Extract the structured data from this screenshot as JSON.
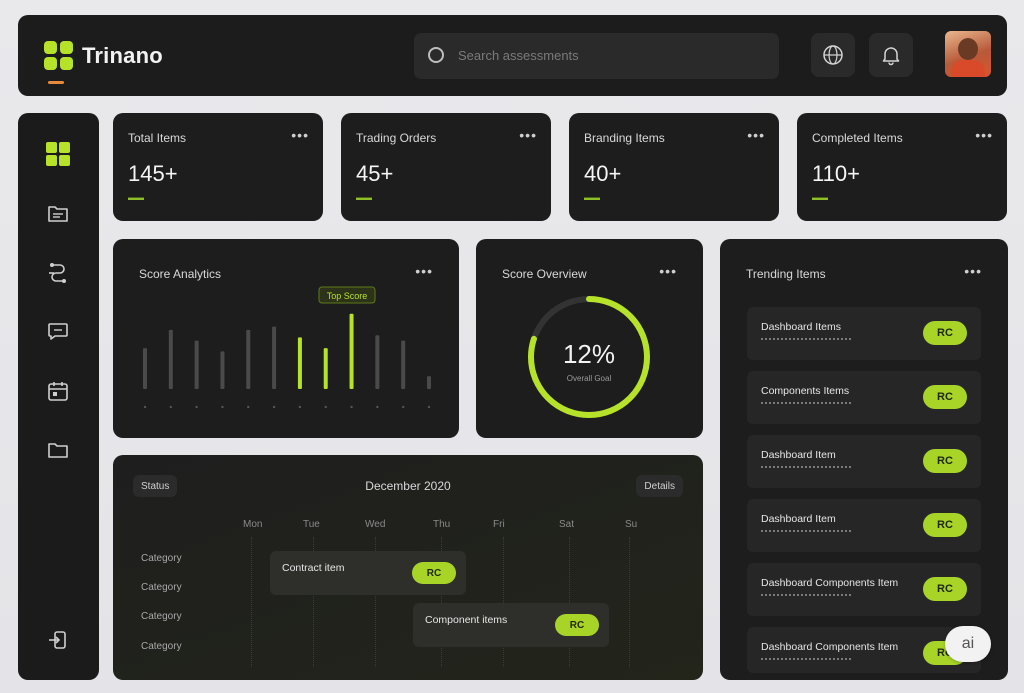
{
  "header": {
    "brand": "Trinano",
    "search_placeholder": "Search assessments",
    "icons": [
      "globe-icon",
      "bell-icon"
    ]
  },
  "sidebar": {
    "items": [
      {
        "name": "dashboard",
        "icon": "grid-icon",
        "active": true
      },
      {
        "name": "documents",
        "icon": "folder-icon"
      },
      {
        "name": "analytics",
        "icon": "network-icon"
      },
      {
        "name": "messages",
        "icon": "chat-icon"
      },
      {
        "name": "calendar",
        "icon": "calendar-icon"
      },
      {
        "name": "files",
        "icon": "folder-outline-icon"
      }
    ],
    "logout_icon": "logout-icon"
  },
  "stats": [
    {
      "title": "Total Items",
      "value": "145+"
    },
    {
      "title": "Trading Orders",
      "value": "45+"
    },
    {
      "title": "Branding Items",
      "value": "40+"
    },
    {
      "title": "Completed Items",
      "value": "110+"
    }
  ],
  "chart": {
    "title": "Score Analytics",
    "tooltip": "Top Score"
  },
  "chart_data": {
    "type": "bar",
    "categories": [
      "",
      "",
      "",
      "",
      "",
      "",
      "",
      "",
      "",
      "",
      "",
      ""
    ],
    "values": [
      38,
      55,
      45,
      35,
      55,
      58,
      48,
      38,
      70,
      50,
      45,
      12
    ],
    "highlight": [
      false,
      false,
      false,
      false,
      false,
      false,
      true,
      true,
      true,
      false,
      false,
      false
    ],
    "ylim": [
      0,
      80
    ],
    "grid": false,
    "colors": {
      "normal": "#4a4a4a",
      "highlight": "#b6e32a"
    }
  },
  "gauge": {
    "title": "Score Overview",
    "value": "12%",
    "sub": "Overall Goal",
    "fraction": 0.8
  },
  "trending": {
    "title": "Trending Items",
    "items": [
      {
        "title": "Dashboard Items",
        "badge": "RC"
      },
      {
        "title": "Components Items",
        "badge": "RC"
      },
      {
        "title": "Dashboard Item",
        "badge": "RC"
      },
      {
        "title": "Dashboard Item",
        "badge": "RC"
      },
      {
        "title": "Dashboard Components Item",
        "badge": "RC"
      },
      {
        "title": "Dashboard Components Item",
        "badge": "RC"
      }
    ]
  },
  "timeline": {
    "title": "December 2020",
    "left_chip": "Status",
    "right_chip": "Details",
    "columns": [
      "Mon",
      "Tue",
      "Wed",
      "Thu",
      "Fri",
      "Sat",
      "Su"
    ],
    "rows": [
      "Category",
      "Category",
      "Category",
      "Category"
    ],
    "events": [
      {
        "title": "Contract item",
        "badge": "RC"
      },
      {
        "title": "Component items",
        "badge": "RC"
      }
    ]
  },
  "ai_badge": "ai",
  "colors": {
    "accent": "#b6e32a",
    "panel": "#1d1d1d",
    "background": "#e6e6ea"
  }
}
